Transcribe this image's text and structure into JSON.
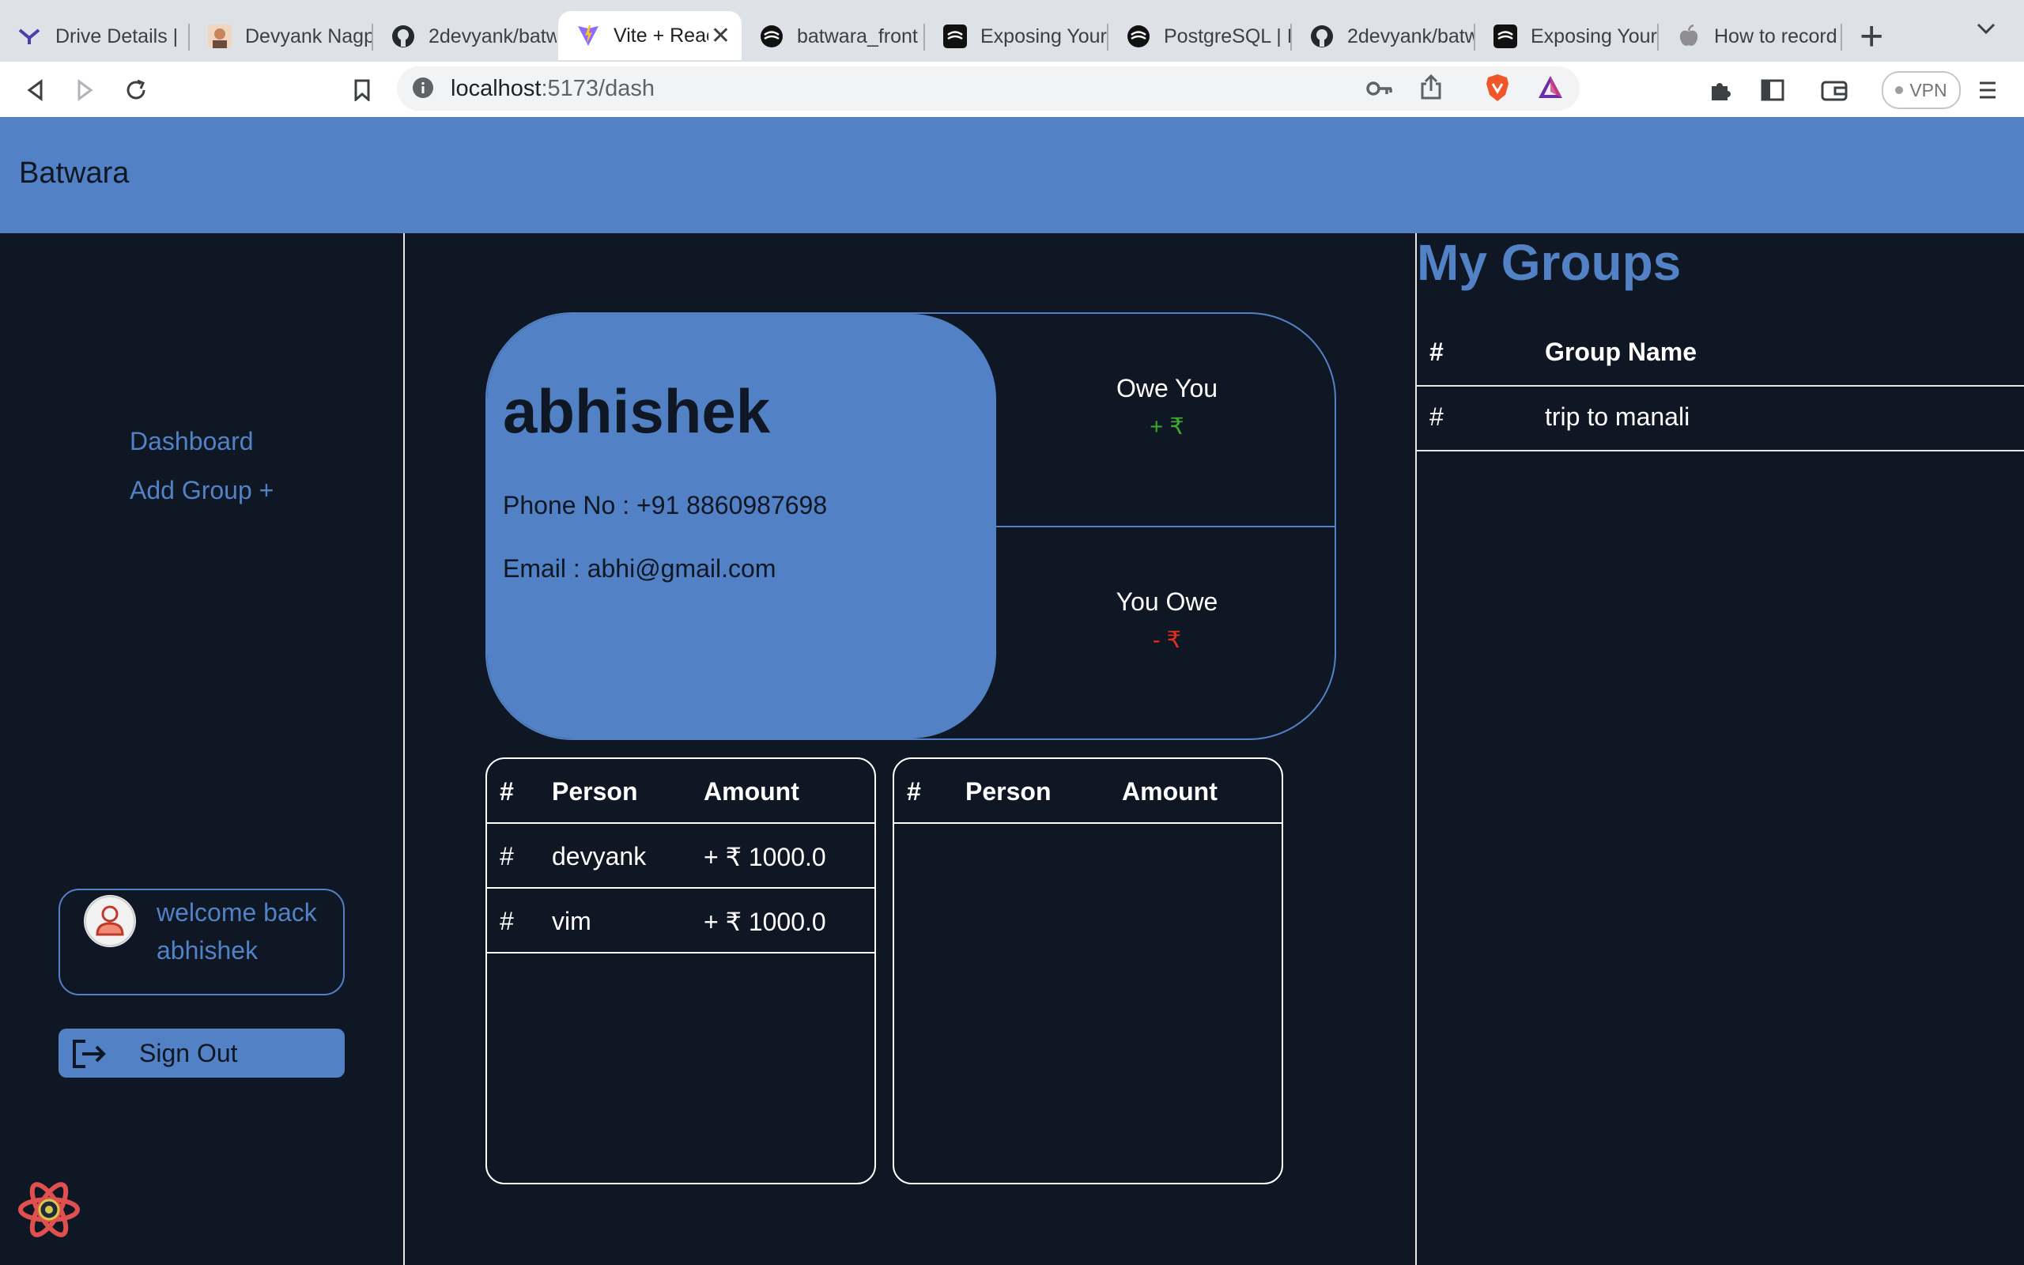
{
  "browser": {
    "tabs": [
      {
        "title": "Drive Details |",
        "icon": "app-icon"
      },
      {
        "title": "Devyank Nagp",
        "icon": "profile-icon"
      },
      {
        "title": "2devyank/batw",
        "icon": "github-icon"
      },
      {
        "title": "Vite + React",
        "icon": "vite-icon",
        "active": true
      },
      {
        "title": "batwara_front",
        "icon": "web-icon"
      },
      {
        "title": "Exposing Your",
        "icon": "web-icon"
      },
      {
        "title": "PostgreSQL | I",
        "icon": "web-icon"
      },
      {
        "title": "2devyank/batw",
        "icon": "github-icon"
      },
      {
        "title": "Exposing Your",
        "icon": "web-icon"
      },
      {
        "title": "How to record",
        "icon": "apple-icon"
      }
    ],
    "url_host": "localhost",
    "url_path": ":5173/dash",
    "vpn_label": "VPN"
  },
  "app": {
    "brand": "Batwara",
    "nav": {
      "dashboard": "Dashboard",
      "add_group": "Add Group +"
    },
    "welcome_line1": "welcome back",
    "welcome_line2": "abhishek",
    "signout_label": "Sign Out",
    "profile": {
      "name": "abhishek",
      "phone": "Phone No : +91 8860987698",
      "email": "Email : abhi@gmail.com"
    },
    "owe_you": {
      "label": "Owe You",
      "value": "+ ₹"
    },
    "you_owe": {
      "label": "You Owe",
      "value": "- ₹"
    },
    "owe_table": {
      "headers": [
        "#",
        "Person",
        "Amount"
      ],
      "rows": [
        {
          "num": "#",
          "person": "devyank",
          "amount": "+ ₹ 1000.0"
        },
        {
          "num": "#",
          "person": "vim",
          "amount": "+ ₹ 1000.0"
        }
      ]
    },
    "owed_table": {
      "headers": [
        "#",
        "Person",
        "Amount"
      ],
      "rows": []
    },
    "groups": {
      "title": "My Groups",
      "headers": [
        "#",
        "Group Name"
      ],
      "rows": [
        {
          "num": "#",
          "name": "trip to manali"
        }
      ]
    },
    "colors": {
      "accent": "#5282c5",
      "background": "#0f1724",
      "positive": "#3ea82f",
      "negative": "#e0301e"
    }
  }
}
